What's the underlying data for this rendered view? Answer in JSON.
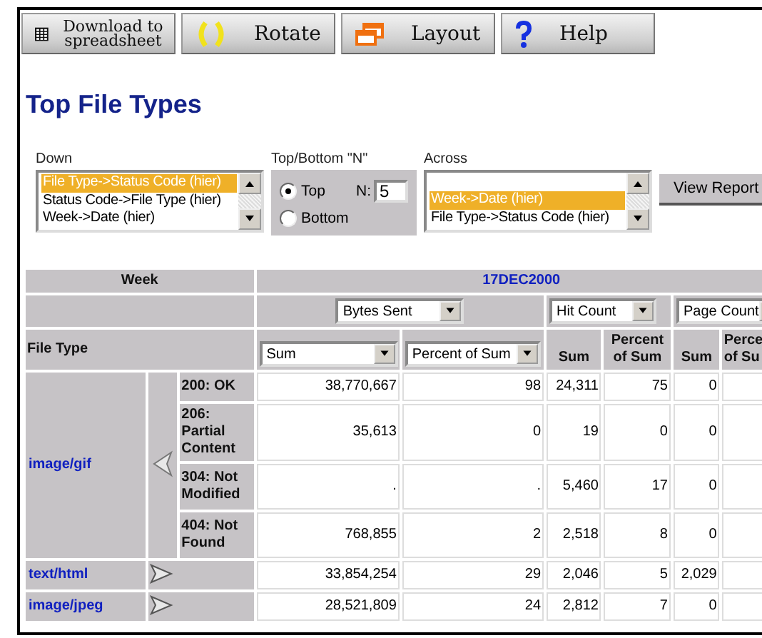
{
  "toolbar": [
    {
      "kind": "grid",
      "label": "Download to spreadsheet"
    },
    {
      "kind": "rotate",
      "label": "Rotate"
    },
    {
      "kind": "windows",
      "label": "Layout"
    },
    {
      "kind": "question",
      "label": "Help"
    }
  ],
  "title": "Top File Types",
  "controls": {
    "down": {
      "label": "Down",
      "options": [
        {
          "label": "File Type->Status Code (hier)",
          "selected": true
        },
        {
          "label": "Status Code->File Type (hier)",
          "selected": false
        },
        {
          "label": "Week->Date (hier)",
          "selected": false
        }
      ]
    },
    "top_bottom": {
      "label": "Top/Bottom \"N\"",
      "options": [
        {
          "label": "Top",
          "selected": true
        },
        {
          "label": "Bottom",
          "selected": false
        }
      ],
      "n_label": "N:",
      "n_value": "5"
    },
    "across": {
      "label": "Across",
      "options": [
        {
          "label": "Week->Date (hier)",
          "selected": true
        },
        {
          "label": "File Type->Status Code (hier)",
          "selected": false
        }
      ]
    },
    "view_button": "View Report"
  },
  "table": {
    "week_header": "Week",
    "date": "17DEC2000",
    "measures": [
      "Bytes Sent",
      "Hit Count",
      "Page Count"
    ],
    "row_header": "File Type",
    "stat_columns": [
      {
        "kind": "select",
        "label": "Sum"
      },
      {
        "kind": "select",
        "label": "Percent of Sum"
      },
      {
        "kind": "text",
        "label": "Sum"
      },
      {
        "kind": "text",
        "label": "Percent of Sum"
      },
      {
        "kind": "text",
        "label": "Sum"
      },
      {
        "kind": "text",
        "label": "Perce\nof Su"
      }
    ],
    "groups": [
      {
        "file_type": "image/gif",
        "expanded": true,
        "children": [
          {
            "status": "200: OK",
            "values": [
              "38,770,667",
              "98",
              "24,311",
              "75",
              "0"
            ]
          },
          {
            "status": "206: Partial Content",
            "values": [
              "35,613",
              "0",
              "19",
              "0",
              "0"
            ]
          },
          {
            "status": "304: Not Modified",
            "values": [
              ".",
              ".",
              "5,460",
              "17",
              "0"
            ]
          },
          {
            "status": "404: Not Found",
            "values": [
              "768,855",
              "2",
              "2,518",
              "8",
              "0"
            ]
          }
        ]
      },
      {
        "file_type": "text/html",
        "expanded": false,
        "values": [
          "33,854,254",
          "29",
          "2,046",
          "5",
          "2,029"
        ]
      },
      {
        "file_type": "image/jpeg",
        "expanded": false,
        "values": [
          "28,521,809",
          "24",
          "2,812",
          "7",
          "0"
        ]
      }
    ]
  }
}
